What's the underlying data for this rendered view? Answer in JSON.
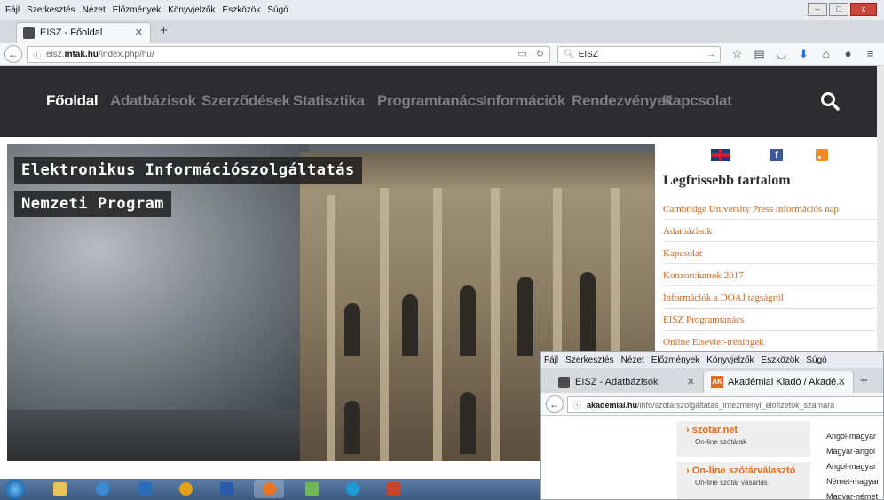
{
  "browser1": {
    "menu": [
      "Fájl",
      "Szerkesztés",
      "Nézet",
      "Előzmények",
      "Könyvjelzők",
      "Eszközök",
      "Súgó"
    ],
    "tab_title": "EISZ - Főoldal",
    "url_prefix": "eisz.",
    "url_host": "mtak.hu",
    "url_path": "/index.php/hu/",
    "search_value": "EISZ"
  },
  "site": {
    "nav": [
      "Főoldal",
      "Adatbázisok",
      "Szerződések",
      "Statisztika",
      "Programtanács",
      "Információk",
      "Rendezvények",
      "Kapcsolat"
    ],
    "hero_line1": "Elektronikus Információszolgáltatás",
    "hero_line2": "Nemzeti Program",
    "sidebar_title": "Legfrissebb tartalom",
    "sidebar_links": [
      "Cambridge University Press információs nap",
      "Adatbázisok",
      "Kapcsolat",
      "Konzorciumok 2017",
      "Információk a DOAJ tagságról",
      "EISZ Programtanács",
      "Online Elsevier-tréningek"
    ]
  },
  "browser2": {
    "menu": [
      "Fájl",
      "Szerkesztés",
      "Nézet",
      "Előzmények",
      "Könyvjelzők",
      "Eszközök",
      "Súgó"
    ],
    "tab1_title": "EISZ - Adatbázisok",
    "tab2_title": "Akadémiai Kiadó / Akadé...",
    "url_host": "akademiai.hu",
    "url_path": "/info/szotarszolgaltatas_intezmenyi_elofizetok_szamara",
    "box1_title": "szotar.net",
    "box1_sub": "On-line szótárak",
    "box2_title": "On-line szótárválasztó",
    "box2_sub": "On-line szótár vásárlás",
    "right_items": [
      "Angol-magyar",
      "Magyar-angol",
      "Angol-magyar",
      "Német-magyar",
      "Magyar-német"
    ]
  },
  "colors": {
    "nav_bg": "#2d2d30",
    "accent_orange": "#d0661f"
  }
}
